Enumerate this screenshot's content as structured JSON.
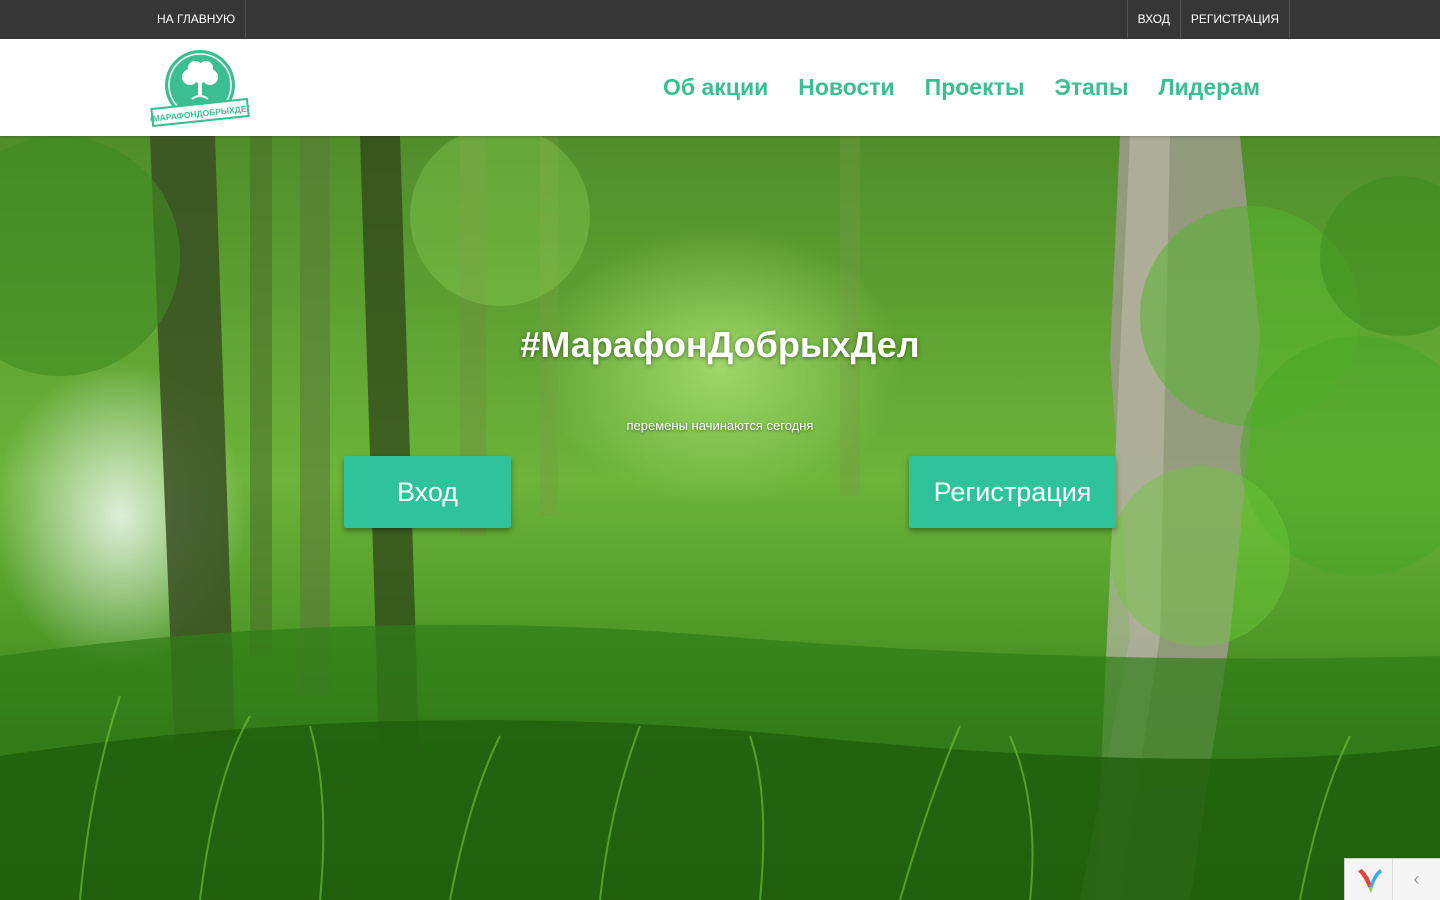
{
  "topbar": {
    "home_link": "НА ГЛАВНУЮ",
    "login_link": "ВХОД",
    "register_link": "РЕГИСТРАЦИЯ"
  },
  "header": {
    "logo_text": "#МАРАФОНДОБРЫХДЕЛ",
    "nav": [
      {
        "label": "Об акции"
      },
      {
        "label": "Новости"
      },
      {
        "label": "Проекты"
      },
      {
        "label": "Этапы"
      },
      {
        "label": "Лидерам"
      }
    ]
  },
  "hero": {
    "title": "#МарафонДобрыхДел",
    "subtitle": "перемены начинаются сегодня",
    "login_button": "Вход",
    "register_button": "Регистрация"
  },
  "debug_toolbar": {
    "toggle_icon": "chevron-left-icon"
  },
  "colors": {
    "accent": "#2ec39a",
    "nav_text": "#3bbf92",
    "topbar_bg": "#363636"
  }
}
